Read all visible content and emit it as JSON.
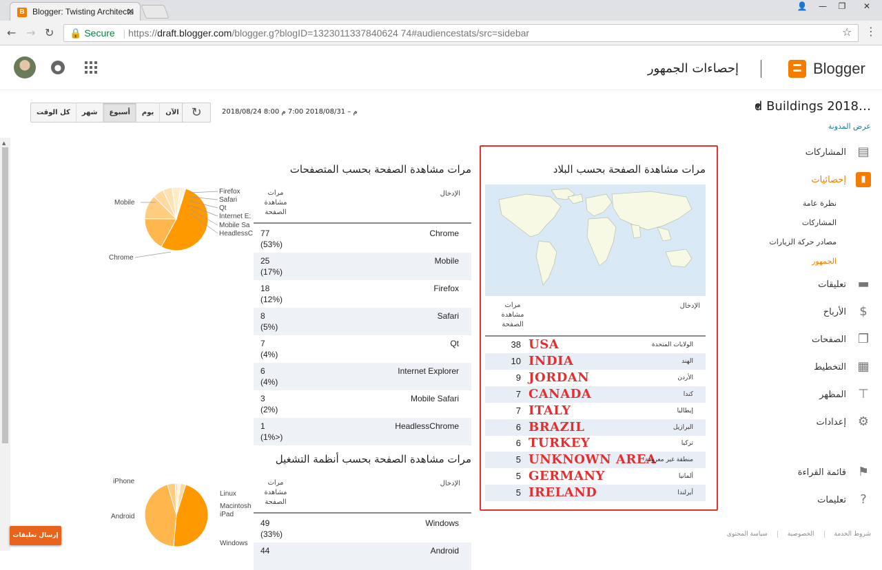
{
  "browser": {
    "tab_title": "Blogger: Twisting Architectu",
    "url_secure_label": "Secure",
    "url_prefix": "https://",
    "url_host": "draft.blogger.com",
    "url_path": "/blogger.g?blogID=1323011337840624 74#audiencestats/src=sidebar"
  },
  "header": {
    "page_title": "إحصاءات الجمهور",
    "brand": "Blogger"
  },
  "toolbar": {
    "ranges": [
      "كل الوقت",
      "شهر",
      "أسبوع",
      "يوم",
      "الآن"
    ],
    "active_range": "أسبوع",
    "date_range": "2018/08/24 8:00 م – 2018/08/31 7:00 م"
  },
  "sidebar": {
    "blog_name": "d Buildings 2018…",
    "view_blog": "عرض المدونة",
    "items": [
      {
        "label": "المشاركات",
        "icon": "posts-icon"
      },
      {
        "label": "إحصائيات",
        "icon": "stats-icon"
      },
      {
        "label": "تعليقات",
        "icon": "comments-icon"
      },
      {
        "label": "الأرباح",
        "icon": "dollar-icon"
      },
      {
        "label": "الصفحات",
        "icon": "pages-icon"
      },
      {
        "label": "التخطيط",
        "icon": "layout-icon"
      },
      {
        "label": "المظهر",
        "icon": "theme-icon"
      },
      {
        "label": "إعدادات",
        "icon": "gear-icon"
      },
      {
        "label": "قائمة القراءة",
        "icon": "bookmark-icon"
      },
      {
        "label": "تعليمات",
        "icon": "help-icon"
      }
    ],
    "stats_sub": [
      "نظرة عامة",
      "المشاركات",
      "مصادر حركة الزيارات",
      "الجمهور"
    ],
    "active_sub": "الجمهور"
  },
  "country_section": {
    "title": "مرات مشاهدة الصفحة بحسب البلاد",
    "col_entry": "الإدخال",
    "col_views": "مرات مشاهدة الصفحة",
    "rows": [
      {
        "ar": "الولايات المتحدة",
        "en": "USA",
        "views": "38"
      },
      {
        "ar": "الهند",
        "en": "INDIA",
        "views": "10"
      },
      {
        "ar": "الأردن",
        "en": "JORDAN",
        "views": "9"
      },
      {
        "ar": "كندا",
        "en": "CANADA",
        "views": "7"
      },
      {
        "ar": "إيطاليا",
        "en": "ITALY",
        "views": "7"
      },
      {
        "ar": "البرازيل",
        "en": "BRAZIL",
        "views": "6"
      },
      {
        "ar": "تركيا",
        "en": "TURKEY",
        "views": "6"
      },
      {
        "ar": "منطقة غير معروفة",
        "en": "UNKNOWN AREA",
        "views": "5"
      },
      {
        "ar": "ألمانيا",
        "en": "GERMANY",
        "views": "5"
      },
      {
        "ar": "أيرلندا",
        "en": "IRELAND",
        "views": "5"
      }
    ]
  },
  "browser_section": {
    "title": "مرات مشاهدة الصفحة بحسب المتصفحات",
    "col_entry": "الإدخال",
    "col_views": "مرات مشاهدة الصفحة",
    "rows": [
      {
        "name": "Chrome",
        "views": "77",
        "pct": "(53%)"
      },
      {
        "name": "Mobile",
        "views": "25",
        "pct": "(17%)"
      },
      {
        "name": "Firefox",
        "views": "18",
        "pct": "(12%)"
      },
      {
        "name": "Safari",
        "views": "8",
        "pct": "(5%)"
      },
      {
        "name": "Qt",
        "views": "7",
        "pct": "(4%)"
      },
      {
        "name": "Internet Explorer",
        "views": "6",
        "pct": "(4%)"
      },
      {
        "name": "Mobile Safari",
        "views": "3",
        "pct": "(2%)"
      },
      {
        "name": "HeadlessChrome",
        "views": "1",
        "pct": "(1%>)"
      }
    ],
    "pie_labels": [
      "Firefox",
      "Safari",
      "Qt",
      "Internet E:",
      "Mobile Sa",
      "HeadlessC",
      "Mobile",
      "Chrome"
    ]
  },
  "os_section": {
    "title": "مرات مشاهدة الصفحة بحسب أنظمة التشغيل",
    "col_entry": "الإدخال",
    "col_views": "مرات مشاهدة الصفحة",
    "rows": [
      {
        "name": "Windows",
        "views": "49",
        "pct": "(33%)"
      },
      {
        "name": "Android",
        "views": "44",
        "pct": ""
      }
    ],
    "pie_labels": [
      "iPhone",
      "Linux",
      "Macintosh",
      "iPad",
      "Android",
      "Windows"
    ]
  },
  "feedback_label": "إرسال تعليقات",
  "footer": [
    "شروط الخدمة",
    "الخصوصية",
    "سياسة المحتوى"
  ],
  "colors": {
    "accent": "#f57c00",
    "highlight_red": "#e52e2e",
    "pie": "#ff9900"
  }
}
